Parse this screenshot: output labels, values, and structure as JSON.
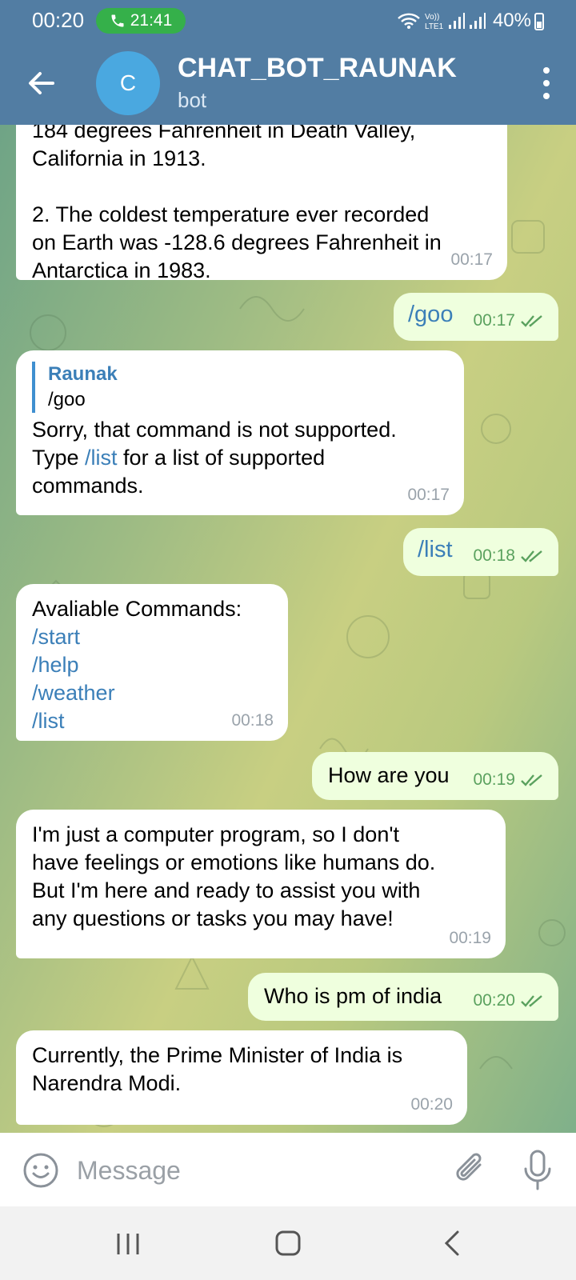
{
  "status_bar": {
    "time": "00:20",
    "call_timer": "21:41",
    "battery": "40%",
    "icons": [
      "phone-icon",
      "wifi-icon",
      "volte-icon",
      "signal-icon",
      "signal-icon",
      "battery-icon"
    ]
  },
  "header": {
    "avatar_letter": "C",
    "title": "CHAT_BOT_RAUNAK",
    "subtitle": "bot",
    "icons": [
      "back-arrow-icon",
      "more-vertical-icon"
    ]
  },
  "messages": [
    {
      "direction": "in",
      "text": "184 degrees Fahrenheit in Death Valley,\nCalifornia in 1913.\n\n2. The coldest temperature ever recorded\non Earth was -128.6 degrees Fahrenheit in\nAntarctica in 1983.",
      "time": "00:17"
    },
    {
      "direction": "out",
      "text": "/goo",
      "time": "00:17"
    },
    {
      "direction": "in",
      "reply_name": "Raunak",
      "reply_text": "/goo",
      "text_before": "Sorry, that command is not supported.\nType ",
      "link": "/list",
      "text_after": " for a list of supported\ncommands.",
      "time": "00:17"
    },
    {
      "direction": "out",
      "text": "/list",
      "time": "00:18"
    },
    {
      "direction": "in",
      "heading": "Avaliable Commands:",
      "commands": [
        "/start",
        "/help",
        "/weather",
        "/list"
      ],
      "time": "00:18"
    },
    {
      "direction": "out",
      "text": "How are you",
      "time": "00:19"
    },
    {
      "direction": "in",
      "text": "I'm just a computer program, so I don't\nhave feelings or emotions like humans do.\nBut I'm here and ready to assist you with\nany questions or tasks you may have!",
      "time": "00:19"
    },
    {
      "direction": "out",
      "text": "Who is pm of india",
      "time": "00:20"
    },
    {
      "direction": "in",
      "text": "Currently, the Prime Minister of India is\nNarendra Modi.",
      "time": "00:20"
    }
  ],
  "input": {
    "placeholder": "Message",
    "icons": [
      "emoji-icon",
      "attach-icon",
      "microphone-icon"
    ]
  },
  "colors": {
    "header": "#527da3",
    "outgoing_bubble": "#efffde",
    "incoming_bubble": "#ffffff",
    "link": "#3b7fb8",
    "read_check": "#5aa15e"
  }
}
